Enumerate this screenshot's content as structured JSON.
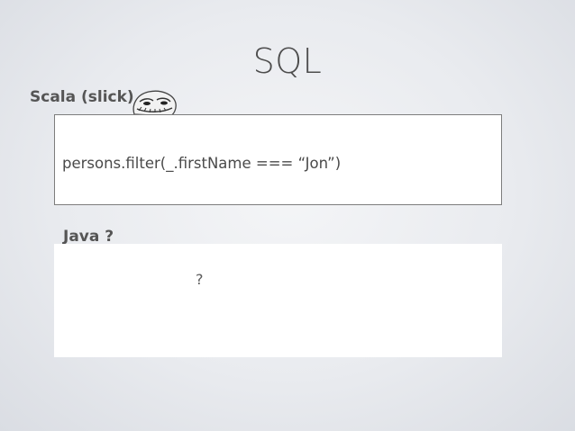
{
  "slide": {
    "title": "SQL"
  },
  "scala": {
    "label": "Scala  (slick)",
    "code": "persons.filter(_.firstName === “Jon”)"
  },
  "java": {
    "label": "Java ?",
    "code": "?"
  },
  "icons": {
    "meme_face": "troll-face-icon"
  }
}
